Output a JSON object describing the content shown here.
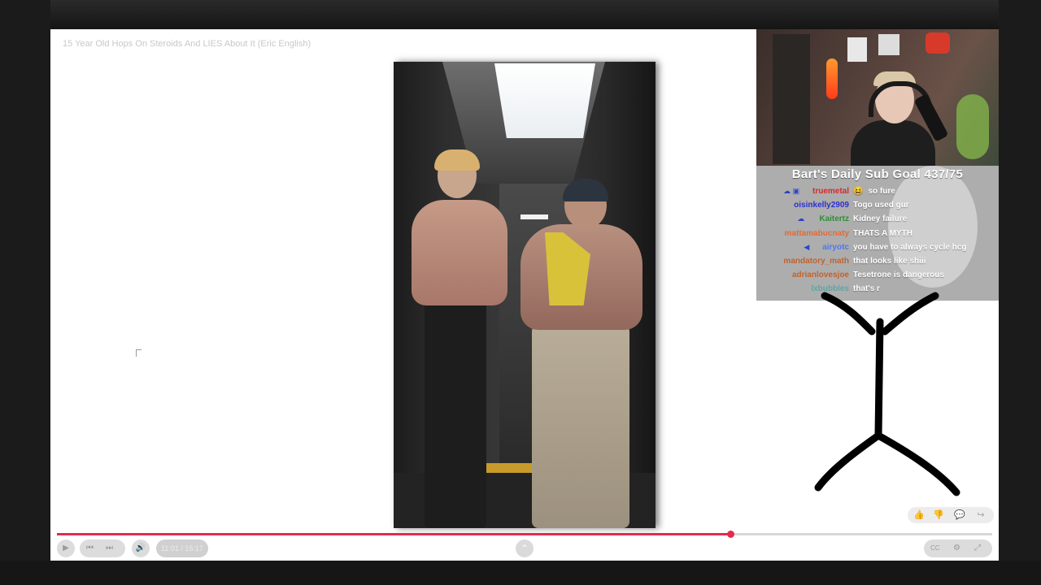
{
  "video": {
    "title": "15 Year Old Hops On Steroids And LIES About It (Eric English)",
    "time": "11:01 / 15:17",
    "progress": 0.72
  },
  "stream": {
    "sub_goal": "Bart's Daily Sub Goal 437/75"
  },
  "chat": {
    "messages": [
      {
        "user": "truemetal",
        "text": "so fure",
        "color": "#d6292b",
        "badges": "☁ ▣",
        "emote": "😆"
      },
      {
        "user": "oisinkelly2909",
        "text": "Togo used gur",
        "color": "#2a2fd1",
        "badges": "",
        "emote": ""
      },
      {
        "user": "Kaitertz",
        "text": "Kidney failure",
        "color": "#2f8f35",
        "badges": "☁",
        "emote": ""
      },
      {
        "user": "mattamabucnaty",
        "text": "THATS A MYTH",
        "color": "#e06b39",
        "badges": "",
        "emote": ""
      },
      {
        "user": "airyotc",
        "text": "you have to always cycle hcg",
        "color": "#4d78f0",
        "badges": "◀",
        "emote": ""
      },
      {
        "user": "mandatory_math",
        "text": "that looks like shiii",
        "color": "#c2622c",
        "badges": "",
        "emote": ""
      },
      {
        "user": "adrianlovesjoe",
        "text": "Tesetrone is dangerous",
        "color": "#c2622c",
        "badges": "",
        "emote": ""
      },
      {
        "user": "lxbubbles",
        "text": "that's r",
        "color": "#5fa6a0",
        "badges": "",
        "emote": ""
      }
    ]
  },
  "controls": {
    "play_icon": "▶",
    "prev_icon": "⏮",
    "next_icon": "⏭",
    "volume_icon": "🔊",
    "chevron_icon": "⌃",
    "captions_icon": "CC",
    "settings_icon": "⚙",
    "fullscreen_icon": "⤢"
  },
  "actions": {
    "like_icon": "👍",
    "dislike_icon": "👎",
    "comment_icon": "💬",
    "share_icon": "↪"
  },
  "colors": {
    "progress": "#e6294f"
  }
}
